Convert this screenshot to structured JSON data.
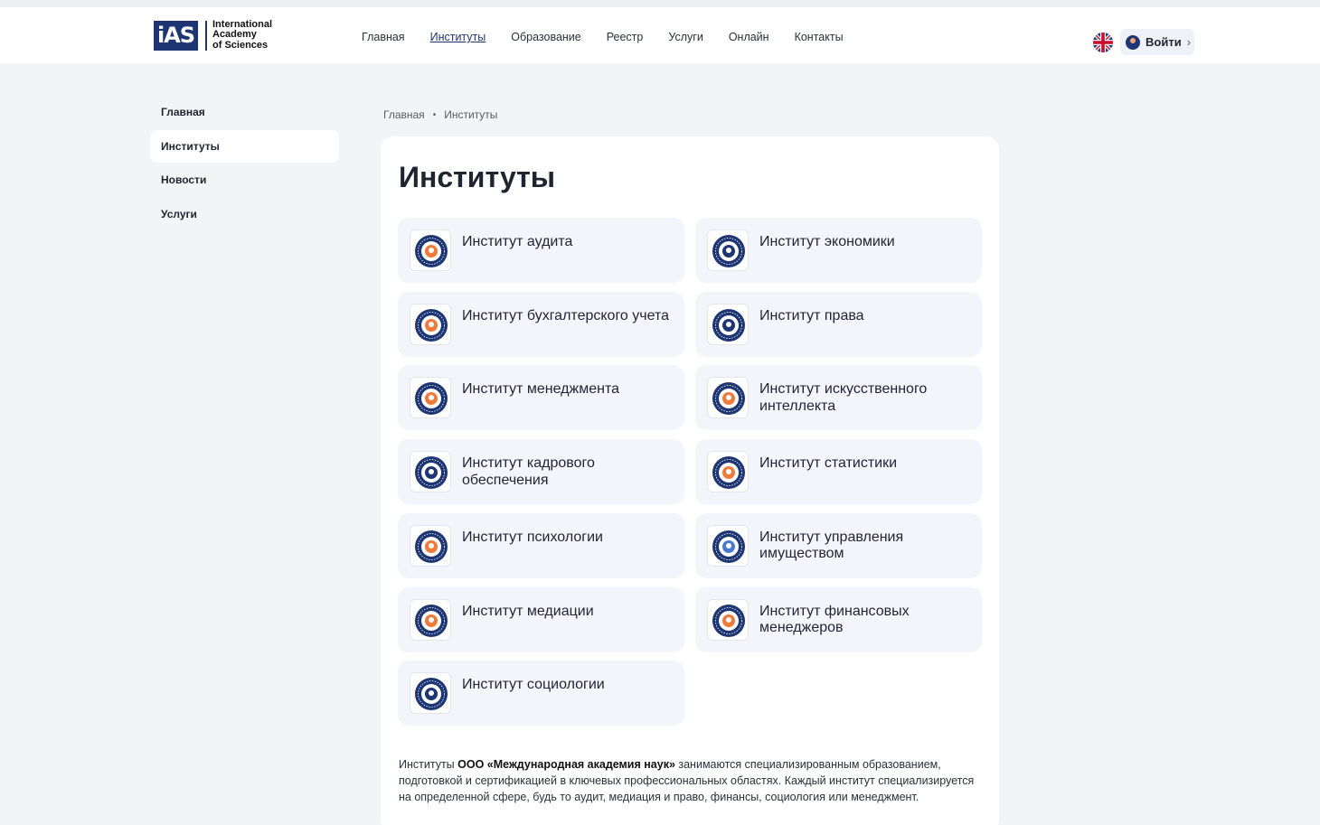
{
  "header": {
    "logo_mark": "iAS",
    "logo_lines": [
      "International",
      "Academy",
      "of Sciences"
    ],
    "nav": [
      {
        "label": "Главная",
        "active": false
      },
      {
        "label": "Институты",
        "active": true
      },
      {
        "label": "Образование",
        "active": false
      },
      {
        "label": "Реестр",
        "active": false
      },
      {
        "label": "Услуги",
        "active": false
      },
      {
        "label": "Онлайн",
        "active": false
      },
      {
        "label": "Контакты",
        "active": false
      }
    ],
    "language_icon": "uk-flag-icon",
    "login_label": "Войти"
  },
  "sidebar": {
    "items": [
      {
        "label": "Главная",
        "active": false
      },
      {
        "label": "Институты",
        "active": true
      },
      {
        "label": "Новости",
        "active": false
      },
      {
        "label": "Услуги",
        "active": false
      }
    ]
  },
  "breadcrumb": [
    "Главная",
    "Институты"
  ],
  "main": {
    "title": "Институты",
    "institutes": [
      {
        "name": "Институт аудита",
        "accent": "#f07a3a"
      },
      {
        "name": "Институт экономики",
        "accent": "#1d3573"
      },
      {
        "name": "Институт бухгалтерского учета",
        "accent": "#f07a3a"
      },
      {
        "name": "Институт права",
        "accent": "#1d3573"
      },
      {
        "name": "Институт менеджмента",
        "accent": "#f07a3a"
      },
      {
        "name": "Институт искусственного интеллекта",
        "accent": "#f07a3a"
      },
      {
        "name": "Институт кадрового обеспечения",
        "accent": "#1d3573"
      },
      {
        "name": "Институт статистики",
        "accent": "#f07a3a"
      },
      {
        "name": "Институт психологии",
        "accent": "#f07a3a"
      },
      {
        "name": "Институт управления имуществом",
        "accent": "#4a7bd0"
      },
      {
        "name": "Институт медиации",
        "accent": "#f07a3a"
      },
      {
        "name": "Институт финансовых менеджеров",
        "accent": "#f07a3a"
      },
      {
        "name": "Институт социологии",
        "accent": "#1d3573"
      }
    ],
    "description": {
      "prefix": "Институты ",
      "bold": "ООО «Международная академия наук»",
      "rest": " занимаются специализированным образованием, подготовкой и сертификацией в ключевых профессиональных областях. Каждый институт специализируется на определенной сфере, будь то аудит, медиация и право, финансы, социология или менеджмент."
    }
  },
  "colors": {
    "brand_navy": "#1d3573",
    "accent_orange": "#f07a3a",
    "page_bg": "#f3f4f6",
    "tile_bg": "#f4f5fa"
  }
}
